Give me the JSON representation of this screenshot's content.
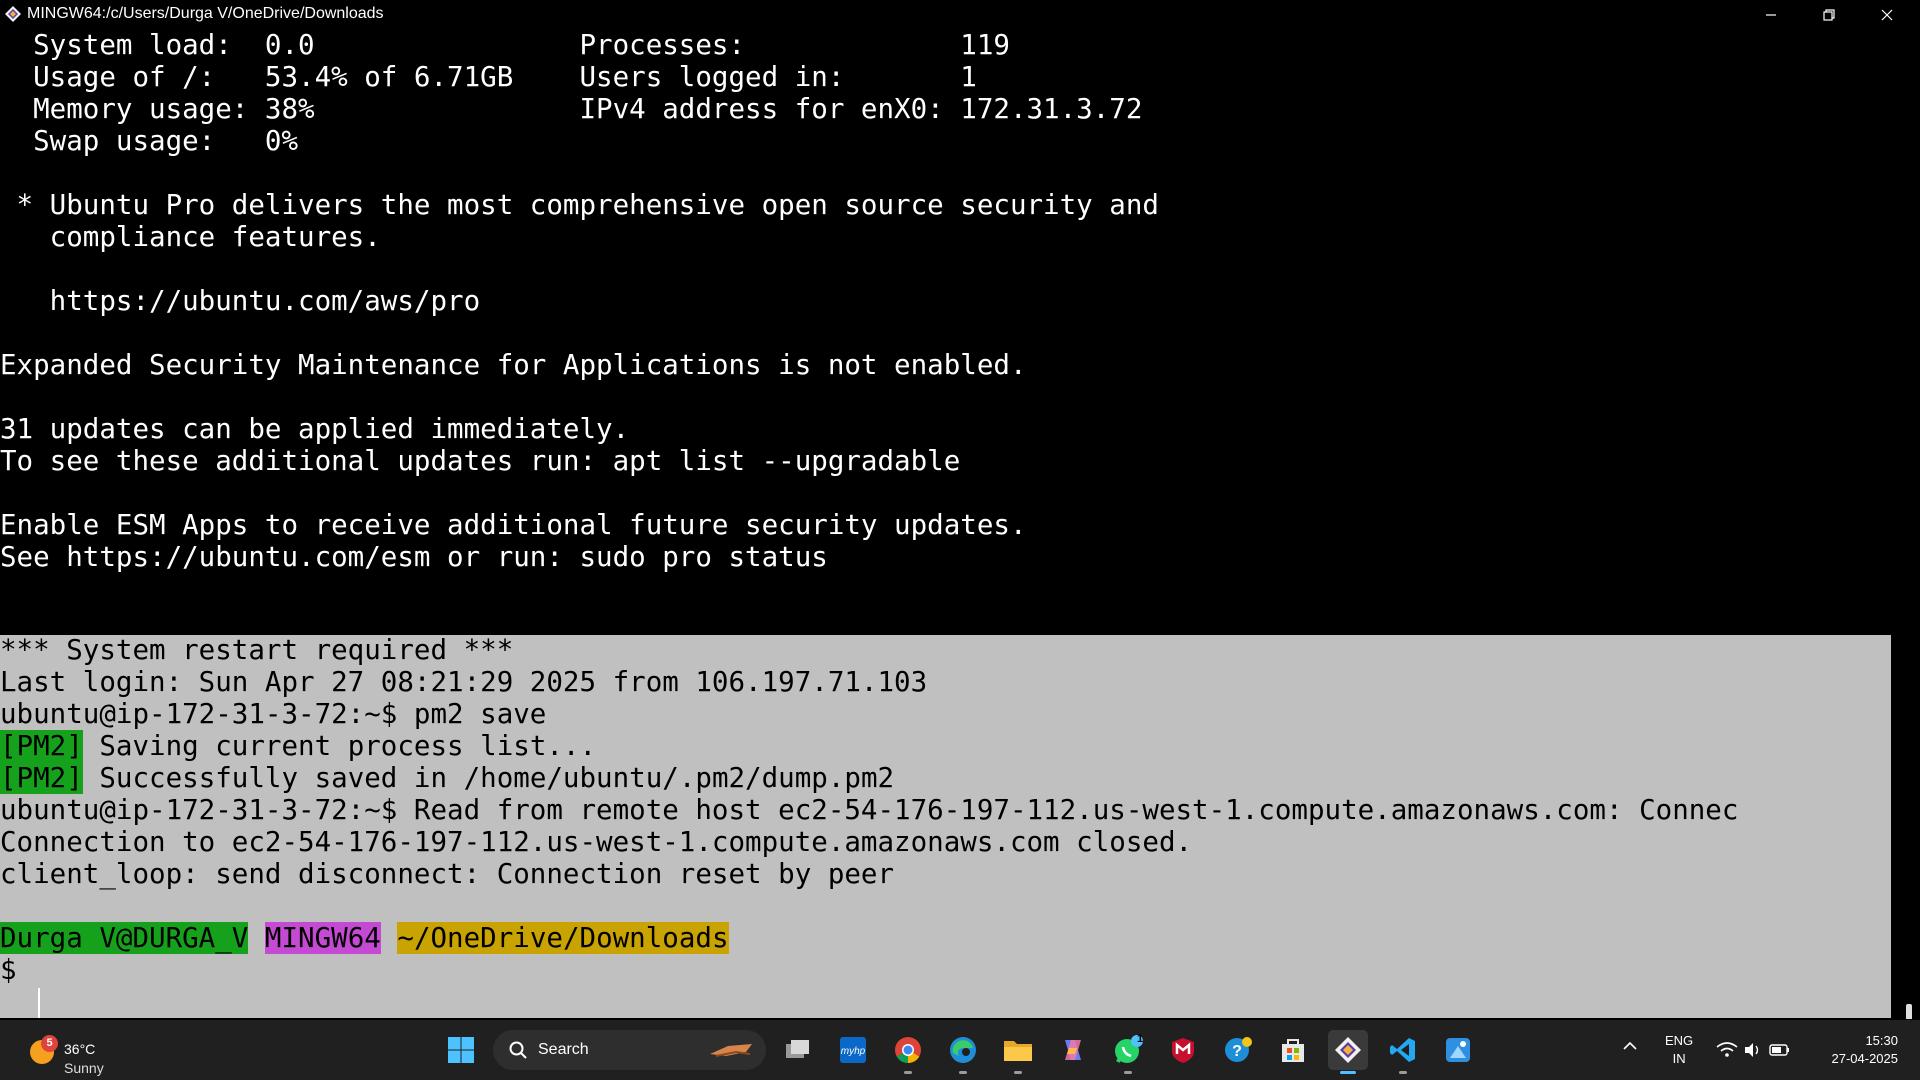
{
  "window": {
    "title": "MINGW64:/c/Users/Durga V/OneDrive/Downloads"
  },
  "terminal": {
    "sysinfo": [
      "  System load:  0.0                Processes:             119",
      "  Usage of /:   53.4% of 6.71GB    Users logged in:       1",
      "  Memory usage: 38%                IPv4 address for enX0: 172.31.3.72",
      "  Swap usage:   0%"
    ],
    "ubuntu_pro": [
      " * Ubuntu Pro delivers the most comprehensive open source security and",
      "   compliance features.",
      "   https://ubuntu.com/aws/pro"
    ],
    "esm_line": "Expanded Security Maintenance for Applications is not enabled.",
    "updates": [
      "31 updates can be applied immediately.",
      "To see these additional updates run: apt list --upgradable"
    ],
    "esm_apps": [
      "Enable ESM Apps to receive additional future security updates.",
      "See https://ubuntu.com/esm or run: sudo pro status"
    ],
    "restart": "*** System restart required ***",
    "last_login": "Last login: Sun Apr 27 08:21:29 2025 from 106.197.71.103",
    "cmd_pm2": "ubuntu@ip-172-31-3-72:~$ pm2 save",
    "pm2_tag": "[PM2]",
    "pm2_msg1": " Saving current process list...",
    "pm2_msg2": " Successfully saved in /home/ubuntu/.pm2/dump.pm2",
    "remote_read": "ubuntu@ip-172-31-3-72:~$ Read from remote host ec2-54-176-197-112.us-west-1.compute.amazonaws.com: Connec",
    "conn_closed": "Connection to ec2-54-176-197-112.us-west-1.compute.amazonaws.com closed.",
    "client_loop": "client_loop: send disconnect: Connection reset by peer",
    "prompt_user": "Durga V@DURGA_V",
    "prompt_sys": "MINGW64",
    "prompt_dir": "~/OneDrive/Downloads",
    "prompt_symbol": "$"
  },
  "taskbar": {
    "weather": {
      "badge": "5",
      "temp": "36°C",
      "condition": "Sunny"
    },
    "search_label": "Search",
    "whatsapp_badge": "1",
    "lang": {
      "line1": "ENG",
      "line2": "IN"
    },
    "clock": {
      "time": "15:30",
      "date": "27-04-2025"
    }
  },
  "colors": {
    "terminal_bg": "#000000",
    "selection_bg": "#c0c0c0",
    "pm2_green": "#15a11b",
    "mingw_magenta": "#c54ad3",
    "path_yellow": "#c8a301",
    "taskbar_bg": "#202020"
  }
}
